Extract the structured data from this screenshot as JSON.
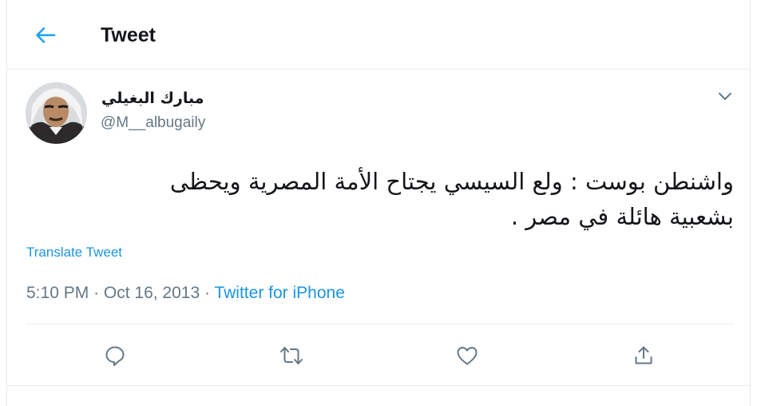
{
  "header": {
    "title": "Tweet",
    "back_icon": "arrow-left-icon"
  },
  "tweet": {
    "author_name": "مبارك البغيلي",
    "handle": "@M__albugaily",
    "text_lines": [
      "واشنطن بوست : ولع السيسي يجتاح الأمة المصرية ويحظى",
      "بشعبية هائلة في مصر ."
    ],
    "translate_label": "Translate Tweet",
    "time": "5:10 PM",
    "separator": "·",
    "date": "Oct 16, 2013",
    "source": "Twitter for iPhone"
  },
  "actions": {
    "reply_icon": "reply-icon",
    "retweet_icon": "retweet-icon",
    "like_icon": "heart-icon",
    "share_icon": "share-icon"
  },
  "colors": {
    "accent": "#1b95e0",
    "text": "#14171a",
    "secondary": "#657786",
    "border": "#e6ecf0"
  }
}
